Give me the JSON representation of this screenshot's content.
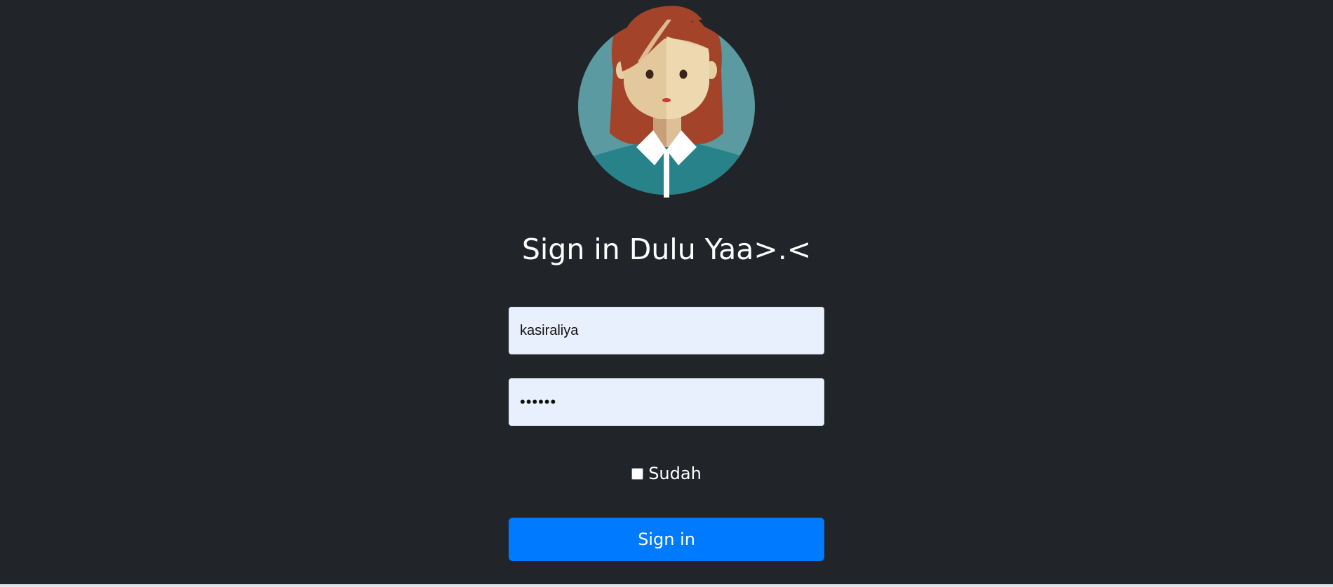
{
  "header": {
    "title": "Sign in Dulu Yaa>.<"
  },
  "avatar": {
    "icon": "woman-avatar-icon",
    "colors": {
      "circle": "#5a9aa0",
      "shirt": "#27828a",
      "hair": "#a3442a",
      "skin": "#eed8b0"
    }
  },
  "form": {
    "username_value": "kasiraliya",
    "password_value": "passwd",
    "remember_label": "Sudah",
    "remember_checked": false,
    "submit_label": "Sign in"
  },
  "colors": {
    "background": "#212529",
    "input_background": "#e8f0fe",
    "button": "#007bff"
  }
}
